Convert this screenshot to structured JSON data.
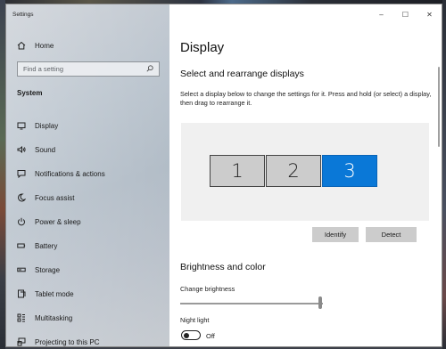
{
  "window": {
    "title": "Settings"
  },
  "controls": {
    "minimize": "–",
    "maximize": "☐",
    "close": "✕"
  },
  "sidebar": {
    "home": {
      "label": "Home",
      "icon": "home-icon"
    },
    "search_placeholder": "Find a setting",
    "section": "System",
    "items": [
      {
        "label": "Display",
        "icon": "display-icon"
      },
      {
        "label": "Sound",
        "icon": "sound-icon"
      },
      {
        "label": "Notifications & actions",
        "icon": "notifications-icon"
      },
      {
        "label": "Focus assist",
        "icon": "moon-icon"
      },
      {
        "label": "Power & sleep",
        "icon": "power-icon"
      },
      {
        "label": "Battery",
        "icon": "battery-icon"
      },
      {
        "label": "Storage",
        "icon": "storage-icon"
      },
      {
        "label": "Tablet mode",
        "icon": "tablet-icon"
      },
      {
        "label": "Multitasking",
        "icon": "multitasking-icon"
      },
      {
        "label": "Projecting to this PC",
        "icon": "projecting-icon"
      }
    ]
  },
  "main": {
    "title": "Display",
    "arrange": {
      "heading": "Select and rearrange displays",
      "description": "Select a display below to change the settings for it. Press and hold (or select) a display, then drag to rearrange it.",
      "monitors": [
        "1",
        "2",
        "3"
      ],
      "selected_monitor": "3",
      "identify_label": "Identify",
      "detect_label": "Detect"
    },
    "brightness": {
      "heading": "Brightness and color",
      "change_label": "Change brightness",
      "level_fraction": 0.98,
      "night_light_label": "Night light",
      "night_light_state": "Off"
    }
  },
  "colors": {
    "accent": "#0a78d7",
    "monitor_default": "#cccccc",
    "button_bg": "#cccccc"
  }
}
